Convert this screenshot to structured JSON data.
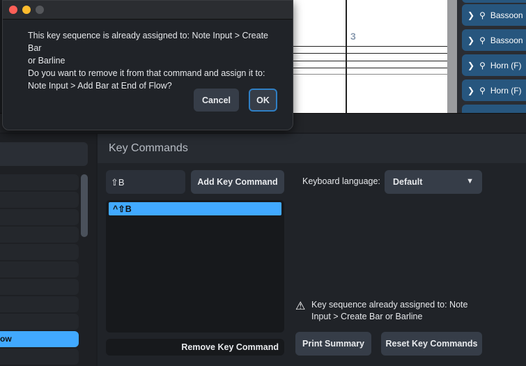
{
  "dialog": {
    "lines": [
      "This key sequence is already assigned to: Note Input > Create Bar",
      "or Barline",
      "Do you want to remove it from that command and assign it to:",
      "Note Input > Add Bar at End of Flow?"
    ],
    "cancel": "Cancel",
    "ok": "OK"
  },
  "score": {
    "bar_number": "3"
  },
  "instruments": [
    "Bassoon",
    "Bassoon",
    "Horn (F)",
    "Horn (F)"
  ],
  "left_list": {
    "selected_label": "ow"
  },
  "key_commands": {
    "title": "Key Commands",
    "input_value": "⇧B",
    "add_button": "Add Key Command",
    "assigned": [
      "^⇧B"
    ],
    "remove_button": "Remove Key Command",
    "keyboard_language_label": "Keyboard language:",
    "keyboard_language_value": "Default",
    "warning": "Key sequence already assigned to: Note Input > Create Bar or Barline",
    "print_button": "Print Summary",
    "reset_button": "Reset Key Commands"
  }
}
